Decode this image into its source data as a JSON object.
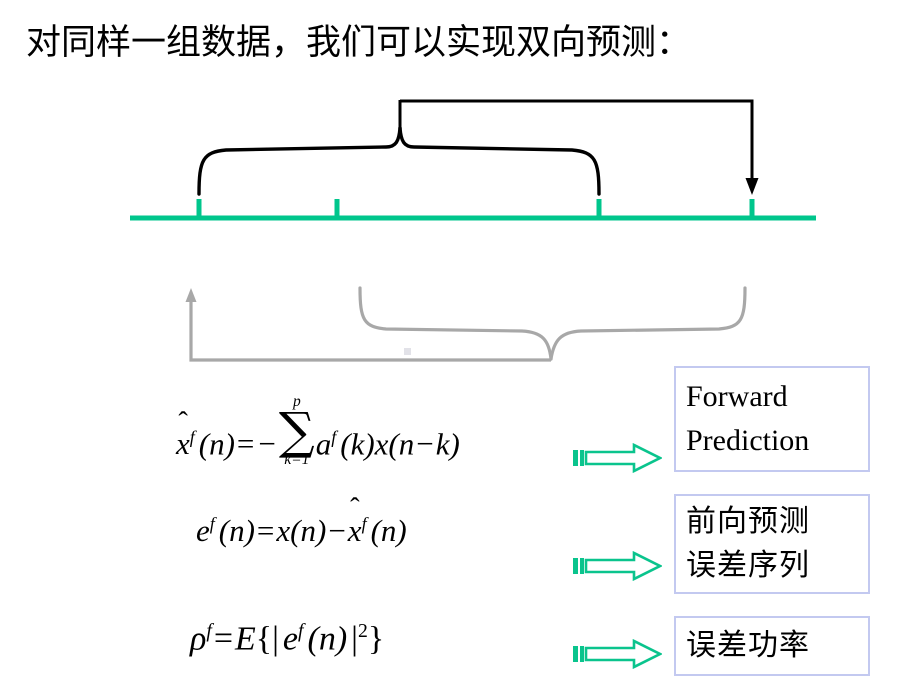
{
  "slide": {
    "title": "对同样一组数据，我们可以实现双向预测：",
    "background_color": "#ffffff"
  },
  "colors": {
    "axis_green": "#00c68c",
    "arrow_green": "#0ac48d",
    "brace_black": "#000000",
    "brace_gray": "#a8a8a8",
    "callout_border": "#c3c9f0",
    "text_black": "#000000"
  },
  "timeline": {
    "name": "data-sample-axis",
    "tick_count": 4,
    "ticks": [
      "tick-1",
      "tick-2",
      "tick-3",
      "tick-4"
    ]
  },
  "annotations": {
    "forward_brace": "forward-window-brace",
    "forward_arrow": "forward-prediction-arrow",
    "backward_brace": "backward-window-brace",
    "backward_arrow": "backward-prediction-arrow"
  },
  "formulas": [
    {
      "id": "forward-predictor",
      "plain": "x̂^f(n) = -Σ_{k=1}^{p} a^f(k) x(n-k)",
      "parts": {
        "lhs_var": "x",
        "hat": "ˆ",
        "sup_f": "f",
        "arg": "(n)",
        "equals": "=",
        "minus": "−",
        "sum": "∑",
        "sum_upper": "p",
        "sum_lower": "k=1",
        "coef": "a",
        "coef_arg": "(k)",
        "signal": "x",
        "signal_arg": "(n − k)"
      }
    },
    {
      "id": "forward-error",
      "plain": "e^f(n) = x(n) - x̂^f(n)",
      "parts": {
        "err": "e",
        "sup_f": "f",
        "arg": "(n)",
        "equals": "=",
        "signal": "x",
        "signal_arg": "(n)",
        "minus": "−",
        "pred": "x",
        "hat": "ˆ",
        "pred_arg": "(n)"
      }
    },
    {
      "id": "forward-error-power",
      "plain": "ρ^f = E{| e^f(n) |^2}",
      "parts": {
        "rho": "ρ",
        "sup_f": "f",
        "equals": "=",
        "expect": "E",
        "open": "{|",
        "err": "e",
        "arg": "(n)",
        "close": "|",
        "power": "2",
        "brace_close": "}"
      }
    }
  ],
  "callouts": [
    {
      "id": "callout-forward-prediction",
      "lines": [
        "Forward",
        "Prediction"
      ]
    },
    {
      "id": "callout-forward-error-sequence",
      "lines": [
        "前向预测",
        "误差序列"
      ]
    },
    {
      "id": "callout-error-power",
      "lines": [
        "误差功率"
      ]
    }
  ],
  "arrows": [
    {
      "id": "green-block-arrow-1",
      "direction": "right"
    },
    {
      "id": "green-block-arrow-2",
      "direction": "right"
    },
    {
      "id": "green-block-arrow-3",
      "direction": "right"
    }
  ]
}
